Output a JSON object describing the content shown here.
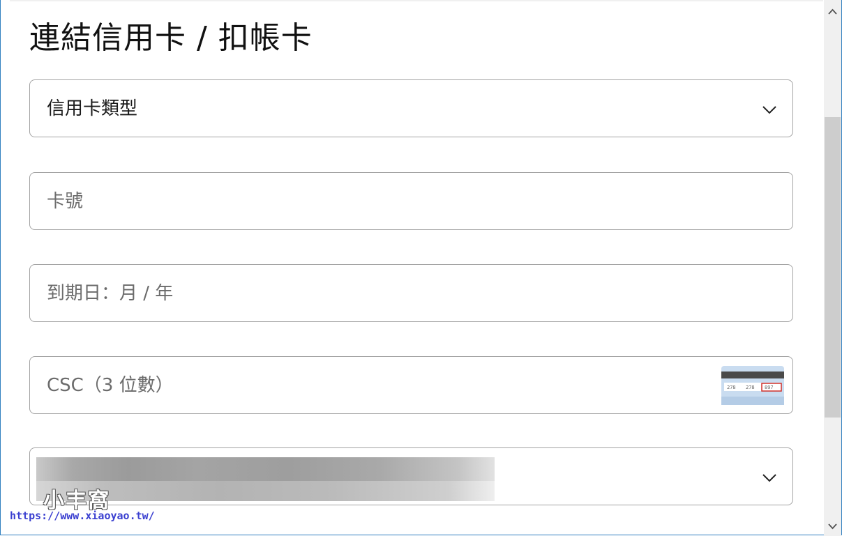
{
  "page": {
    "title": "連結信用卡 / 扣帳卡"
  },
  "form": {
    "card_type": {
      "label": "信用卡類型",
      "icon": "chevron-down-icon"
    },
    "card_number": {
      "placeholder": "卡號"
    },
    "expiry": {
      "placeholder": "到期日：月 / 年"
    },
    "csc": {
      "placeholder": "CSC（3 位數）",
      "icon": "card-back-csc-icon",
      "card_digits": [
        "278",
        "278",
        "897"
      ]
    },
    "billing_select": {
      "icon": "chevron-down-icon"
    }
  },
  "watermark": {
    "logo_text": "小丰窩",
    "url": "https://www.xiaoyao.tw/"
  },
  "colors": {
    "border": "#a3a3a3",
    "text": "#1a1a1a",
    "placeholder": "#6b6b6b",
    "scrollbar_thumb": "#cdcdcd"
  }
}
